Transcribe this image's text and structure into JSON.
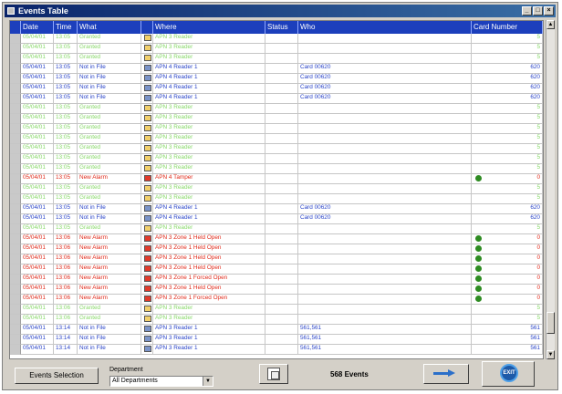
{
  "window": {
    "title": "Events Table",
    "controls": [
      "_",
      "□",
      "×"
    ]
  },
  "columns": [
    "Date",
    "Time",
    "What",
    "",
    "Where",
    "Status",
    "Who",
    "Card Number"
  ],
  "colors": {
    "normal": "#88d86a",
    "reader": "#2a44c8",
    "alarm": "#e02a1a",
    "header_bg": "#1c3fbc",
    "header_text": "#ffffff"
  },
  "rows": [
    {
      "date": "05/04/01",
      "time": "13:05",
      "what": "Granted",
      "icon": "normal",
      "where": "APN 3 Reader",
      "status": "",
      "who": "",
      "card": "5",
      "kind": "normal"
    },
    {
      "date": "05/04/01",
      "time": "13:05",
      "what": "Granted",
      "icon": "normal",
      "where": "APN 3 Reader",
      "status": "",
      "who": "",
      "card": "5",
      "kind": "normal"
    },
    {
      "date": "05/04/01",
      "time": "13:05",
      "what": "Granted",
      "icon": "normal",
      "where": "APN 3 Reader",
      "status": "",
      "who": "",
      "card": "5",
      "kind": "normal"
    },
    {
      "date": "05/04/01",
      "time": "13:05",
      "what": "Not in File",
      "icon": "reader",
      "where": "APN 4 Reader 1",
      "status": "",
      "who": "Card 00620",
      "card": "620",
      "kind": "reader"
    },
    {
      "date": "05/04/01",
      "time": "13:05",
      "what": "Not in File",
      "icon": "reader",
      "where": "APN 4 Reader 1",
      "status": "",
      "who": "Card 00620",
      "card": "620",
      "kind": "reader"
    },
    {
      "date": "05/04/01",
      "time": "13:05",
      "what": "Not in File",
      "icon": "reader",
      "where": "APN 4 Reader 1",
      "status": "",
      "who": "Card 00620",
      "card": "620",
      "kind": "reader"
    },
    {
      "date": "05/04/01",
      "time": "13:05",
      "what": "Not in File",
      "icon": "reader",
      "where": "APN 4 Reader 1",
      "status": "",
      "who": "Card 00620",
      "card": "620",
      "kind": "reader"
    },
    {
      "date": "05/04/01",
      "time": "13:05",
      "what": "Granted",
      "icon": "normal",
      "where": "APN 3 Reader",
      "status": "",
      "who": "",
      "card": "5",
      "kind": "normal"
    },
    {
      "date": "05/04/01",
      "time": "13:05",
      "what": "Granted",
      "icon": "normal",
      "where": "APN 3 Reader",
      "status": "",
      "who": "",
      "card": "5",
      "kind": "normal"
    },
    {
      "date": "05/04/01",
      "time": "13:05",
      "what": "Granted",
      "icon": "normal",
      "where": "APN 3 Reader",
      "status": "",
      "who": "",
      "card": "5",
      "kind": "normal"
    },
    {
      "date": "05/04/01",
      "time": "13:05",
      "what": "Granted",
      "icon": "normal",
      "where": "APN 3 Reader",
      "status": "",
      "who": "",
      "card": "5",
      "kind": "normal"
    },
    {
      "date": "05/04/01",
      "time": "13:05",
      "what": "Granted",
      "icon": "normal",
      "where": "APN 3 Reader",
      "status": "",
      "who": "",
      "card": "5",
      "kind": "normal"
    },
    {
      "date": "05/04/01",
      "time": "13:05",
      "what": "Granted",
      "icon": "normal",
      "where": "APN 3 Reader",
      "status": "",
      "who": "",
      "card": "5",
      "kind": "normal"
    },
    {
      "date": "05/04/01",
      "time": "13:05",
      "what": "Granted",
      "icon": "normal",
      "where": "APN 3 Reader",
      "status": "",
      "who": "",
      "card": "5",
      "kind": "normal"
    },
    {
      "date": "05/04/01",
      "time": "13:05",
      "what": "New Alarm",
      "icon": "alarm",
      "where": "APN 4 Tamper",
      "status": "",
      "who": "",
      "card": "0",
      "kind": "alarm",
      "dot": true
    },
    {
      "date": "05/04/01",
      "time": "13:05",
      "what": "Granted",
      "icon": "normal",
      "where": "APN 3 Reader",
      "status": "",
      "who": "",
      "card": "5",
      "kind": "normal"
    },
    {
      "date": "05/04/01",
      "time": "13:05",
      "what": "Granted",
      "icon": "normal",
      "where": "APN 3 Reader",
      "status": "",
      "who": "",
      "card": "5",
      "kind": "normal"
    },
    {
      "date": "05/04/01",
      "time": "13:05",
      "what": "Not in File",
      "icon": "reader",
      "where": "APN 4 Reader 1",
      "status": "",
      "who": "Card 00620",
      "card": "620",
      "kind": "reader"
    },
    {
      "date": "05/04/01",
      "time": "13:05",
      "what": "Not in File",
      "icon": "reader",
      "where": "APN 4 Reader 1",
      "status": "",
      "who": "Card 00620",
      "card": "620",
      "kind": "reader"
    },
    {
      "date": "05/04/01",
      "time": "13:05",
      "what": "Granted",
      "icon": "normal",
      "where": "APN 3 Reader",
      "status": "",
      "who": "",
      "card": "5",
      "kind": "normal"
    },
    {
      "date": "05/04/01",
      "time": "13:06",
      "what": "New Alarm",
      "icon": "alarm",
      "where": "APN 3 Zone 1 Held Open",
      "status": "",
      "who": "",
      "card": "0",
      "kind": "alarm",
      "dot": true
    },
    {
      "date": "05/04/01",
      "time": "13:06",
      "what": "New Alarm",
      "icon": "alarm",
      "where": "APN 3 Zone 1 Held Open",
      "status": "",
      "who": "",
      "card": "0",
      "kind": "alarm",
      "dot": true
    },
    {
      "date": "05/04/01",
      "time": "13:06",
      "what": "New Alarm",
      "icon": "alarm",
      "where": "APN 3 Zone 1 Held Open",
      "status": "",
      "who": "",
      "card": "0",
      "kind": "alarm",
      "dot": true
    },
    {
      "date": "05/04/01",
      "time": "13:06",
      "what": "New Alarm",
      "icon": "alarm",
      "where": "APN 3 Zone 1 Held Open",
      "status": "",
      "who": "",
      "card": "0",
      "kind": "alarm",
      "dot": true
    },
    {
      "date": "05/04/01",
      "time": "13:06",
      "what": "New Alarm",
      "icon": "alarm",
      "where": "APN 3 Zone 1 Forced Open",
      "status": "",
      "who": "",
      "card": "0",
      "kind": "alarm",
      "dot": true
    },
    {
      "date": "05/04/01",
      "time": "13:06",
      "what": "New Alarm",
      "icon": "alarm",
      "where": "APN 3 Zone 1 Held Open",
      "status": "",
      "who": "",
      "card": "0",
      "kind": "alarm",
      "dot": true
    },
    {
      "date": "05/04/01",
      "time": "13:06",
      "what": "New Alarm",
      "icon": "alarm",
      "where": "APN 3 Zone 1 Forced Open",
      "status": "",
      "who": "",
      "card": "0",
      "kind": "alarm",
      "dot": true
    },
    {
      "date": "05/04/01",
      "time": "13:06",
      "what": "Granted",
      "icon": "normal",
      "where": "APN 3 Reader",
      "status": "",
      "who": "",
      "card": "5",
      "kind": "normal"
    },
    {
      "date": "05/04/01",
      "time": "13:06",
      "what": "Granted",
      "icon": "normal",
      "where": "APN 3 Reader",
      "status": "",
      "who": "",
      "card": "5",
      "kind": "normal"
    },
    {
      "date": "05/04/01",
      "time": "13:14",
      "what": "Not in File",
      "icon": "reader",
      "where": "APN 3 Reader 1",
      "status": "",
      "who": "561,561",
      "card": "561",
      "kind": "reader"
    },
    {
      "date": "05/04/01",
      "time": "13:14",
      "what": "Not in File",
      "icon": "reader",
      "where": "APN 3 Reader 1",
      "status": "",
      "who": "561,561",
      "card": "561",
      "kind": "reader"
    },
    {
      "date": "05/04/01",
      "time": "13:14",
      "what": "Not in File",
      "icon": "reader",
      "where": "APN 3 Reader 1",
      "status": "",
      "who": "561,561",
      "card": "561",
      "kind": "reader"
    }
  ],
  "footer": {
    "events_selection": "Events Selection",
    "department_label": "Department",
    "department_value": "All Departments",
    "event_count": "568 Events"
  }
}
